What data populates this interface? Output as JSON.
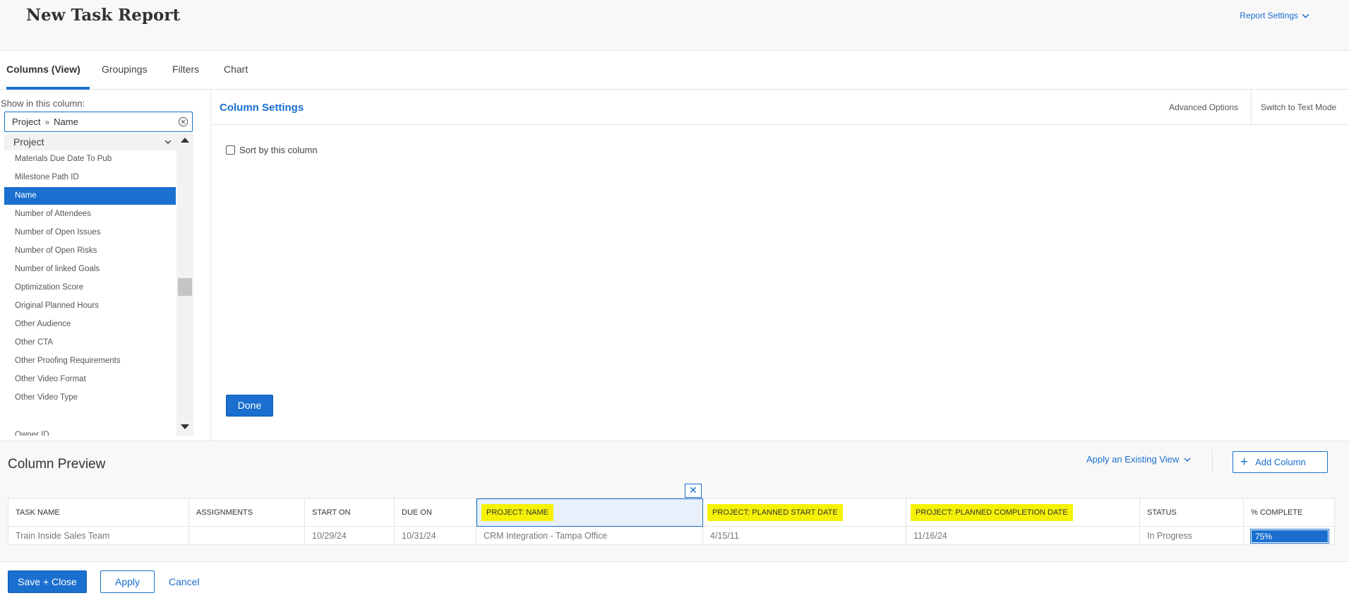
{
  "header": {
    "title": "New Task Report",
    "report_settings": "Report Settings"
  },
  "tabs": [
    "Columns (View)",
    "Groupings",
    "Filters",
    "Chart"
  ],
  "left": {
    "show_label": "Show in this column:",
    "field_path": [
      "Project",
      "Name"
    ],
    "group": "Project",
    "items": [
      "Materials Due Date To Pub",
      "Milestone Path ID",
      "Name",
      "Number of Attendees",
      "Number of Open Issues",
      "Number of Open Risks",
      "Number of linked Goals",
      "Optimization Score",
      "Original Planned Hours",
      "Other Audience",
      "Other CTA",
      "Other Proofing Requirements",
      "Other Video Format",
      "Other Video Type",
      "Owner ID"
    ],
    "selected_index": 2
  },
  "settings": {
    "title": "Column Settings",
    "advanced_options": "Advanced Options",
    "switch_text_mode": "Switch to Text Mode",
    "sort_label": "Sort by this column",
    "done": "Done"
  },
  "preview": {
    "title": "Column Preview",
    "apply_view": "Apply an Existing View",
    "add_column": "Add Column",
    "close_symbol": "✕",
    "columns": [
      "TASK NAME",
      "ASSIGNMENTS",
      "START ON",
      "DUE ON",
      "PROJECT: NAME",
      "PROJECT: PLANNED START DATE",
      "PROJECT: PLANNED COMPLETION DATE",
      "STATUS",
      "% COMPLETE"
    ],
    "highlighted_columns": [
      4,
      5,
      6
    ],
    "row": [
      "Train Inside Sales Team",
      "",
      "10/29/24",
      "10/31/24",
      "CRM Integration - Tampa Office",
      "4/15/11",
      "11/16/24",
      "In Progress",
      "75%"
    ]
  },
  "footer": {
    "save_close": "Save + Close",
    "apply": "Apply",
    "cancel": "Cancel"
  },
  "colors": {
    "accent": "#1a6fcf",
    "highlight": "#f5f107",
    "selected_column_bg": "#e8f0fb"
  }
}
